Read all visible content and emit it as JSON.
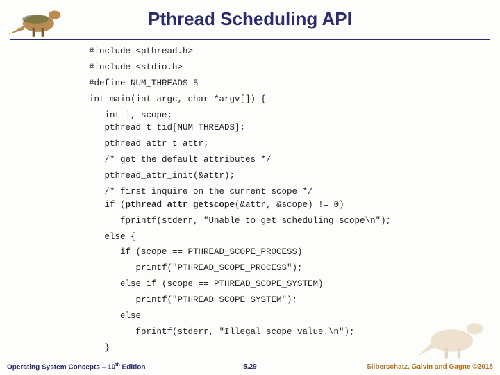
{
  "title": "Pthread Scheduling API",
  "code": {
    "l1": "#include <pthread.h>",
    "l2": "#include <stdio.h>",
    "l3": "#define NUM_THREADS 5",
    "l4": "int main(int argc, char *argv[]) {",
    "l5a": "   int i, scope;",
    "l5b": "   pthread_t tid[NUM THREADS];",
    "l6": "   pthread_attr_t attr;",
    "l7": "   /* get the default attributes */",
    "l8": "   pthread_attr_init(&attr);",
    "l9a": "   /* first inquire on the current scope */",
    "l9b_pre": "   if (",
    "l9b_bold": "pthread_attr_getscope",
    "l9b_post": "(&attr, &scope) != 0)",
    "l10": "      fprintf(stderr, \"Unable to get scheduling scope\\n\");",
    "l11": "   else {",
    "l12": "      if (scope == PTHREAD_SCOPE_PROCESS)",
    "l13": "         printf(\"PTHREAD_SCOPE_PROCESS\");",
    "l14": "      else if (scope == PTHREAD_SCOPE_SYSTEM)",
    "l15": "         printf(\"PTHREAD_SCOPE_SYSTEM\");",
    "l16": "      else",
    "l17": "         fprintf(stderr, \"Illegal scope value.\\n\");",
    "l18": "   }"
  },
  "footer": {
    "left_pre": "Operating System Concepts – 10",
    "left_sup": "th",
    "left_post": " Edition",
    "center": "5.29",
    "right": "Silberschatz, Galvin and Gagne ©2018"
  }
}
